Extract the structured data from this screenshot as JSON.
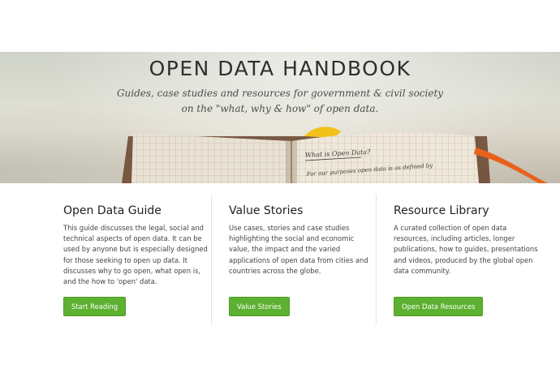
{
  "hero": {
    "title": "OPEN DATA HANDBOOK",
    "subtitle_line1": "Guides, case studies and resources for government & civil society",
    "subtitle_line2": "on the \"what, why & how\" of open data.",
    "notebook_heading": "What is Open Data?",
    "notebook_line": "For our purposes open data is as defined by"
  },
  "columns": [
    {
      "title": "Open Data Guide",
      "body": "This guide discusses the legal, social and technical aspects of open data. It can be used by anyone but is especially designed for those seeking to open up data. It discusses why to go open, what open is, and the how to 'open' data.",
      "button": "Start Reading"
    },
    {
      "title": "Value Stories",
      "body": "Use cases, stories and case studies highlighting the social and economic value, the impact and the varied applications of open data from cities and countries across the globe.",
      "button": "Value Stories"
    },
    {
      "title": "Resource Library",
      "body": "A curated collection of open data resources, including articles, longer publications, how to guides, presentations and videos, produced by the global open data community.",
      "button": "Open Data Resources"
    }
  ],
  "colors": {
    "button": "#5cb130",
    "title": "#2f2f2f",
    "text": "#444444"
  },
  "icons": {
    "hero_image": "open-notebook-image"
  }
}
